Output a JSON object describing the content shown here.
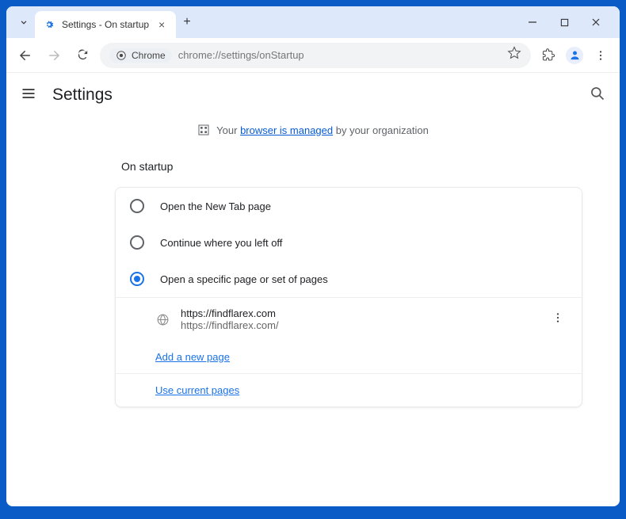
{
  "window": {
    "tab_title": "Settings - On startup"
  },
  "toolbar": {
    "chrome_chip": "Chrome",
    "url": "chrome://settings/onStartup"
  },
  "header": {
    "title": "Settings"
  },
  "banner": {
    "prefix": "Your ",
    "link": "browser is managed",
    "suffix": " by your organization"
  },
  "section": {
    "title": "On startup",
    "options": [
      "Open the New Tab page",
      "Continue where you left off",
      "Open a specific page or set of pages"
    ],
    "page": {
      "title": "https://findflarex.com",
      "url": "https://findflarex.com/"
    },
    "add_link": "Add a new page",
    "use_current_link": "Use current pages"
  }
}
